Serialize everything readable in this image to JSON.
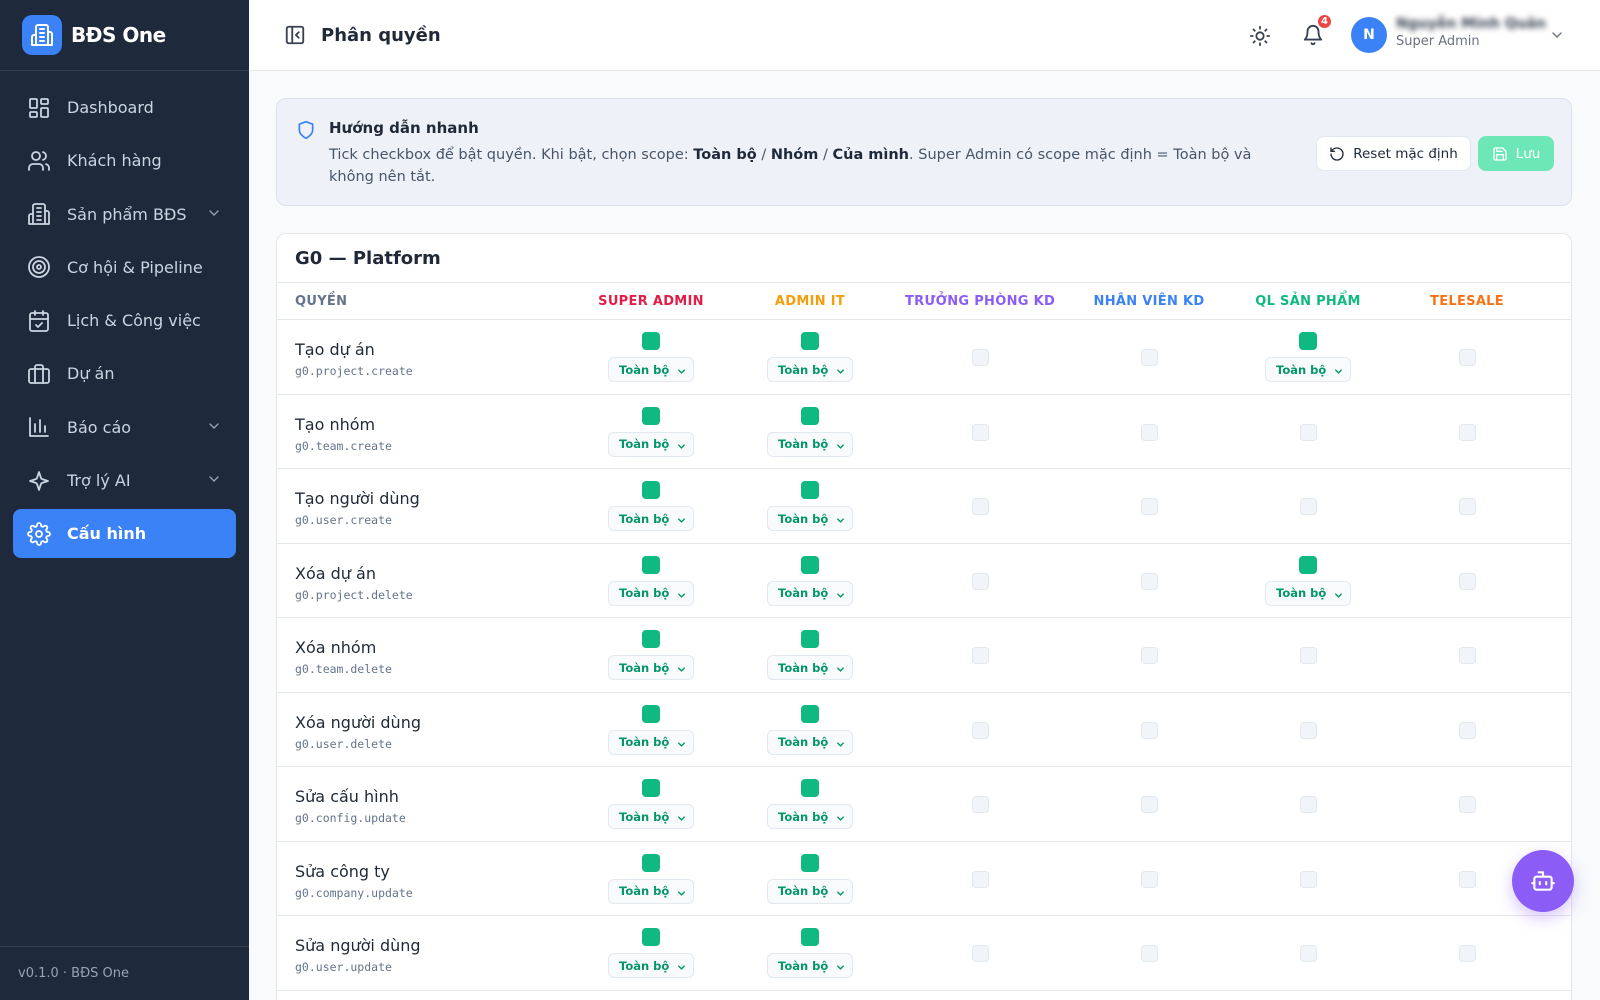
{
  "brand": {
    "name": "BĐS One"
  },
  "sidebar": {
    "items": [
      {
        "label": "Dashboard",
        "icon": "dashboard-icon"
      },
      {
        "label": "Khách hàng",
        "icon": "users-icon"
      },
      {
        "label": "Sản phẩm BĐS",
        "icon": "building-icon",
        "expandable": true
      },
      {
        "label": "Cơ hội & Pipeline",
        "icon": "target-icon"
      },
      {
        "label": "Lịch & Công việc",
        "icon": "calendar-icon"
      },
      {
        "label": "Dự án",
        "icon": "briefcase-icon"
      },
      {
        "label": "Báo cáo",
        "icon": "chart-icon",
        "expandable": true
      },
      {
        "label": "Trợ lý AI",
        "icon": "sparkles-icon",
        "expandable": true
      },
      {
        "label": "Cấu hình",
        "icon": "gear-icon",
        "active": true
      }
    ],
    "footer": "v0.1.0 · BĐS One"
  },
  "header": {
    "title": "Phân quyền",
    "notifications_count": "4",
    "avatar_initial": "N",
    "user_name": "Nguyễn Minh Quân",
    "user_role": "Super Admin"
  },
  "guide": {
    "title": "Hướng dẫn nhanh",
    "text_1": "Tick checkbox để bật quyền. Khi bật, chọn scope: ",
    "scope_all": "Toàn bộ",
    "sep": " / ",
    "scope_group": "Nhóm",
    "scope_own": "Của mình",
    "text_2": ". Super Admin có scope mặc định = Toàn bộ và không nên tắt.",
    "reset_label": "Reset mặc định",
    "save_label": "Lưu"
  },
  "colors": {
    "accent": "#3b82f6",
    "enabled": "#10b981",
    "sidebar_bg": "#1e293b",
    "fab": "#8b5cf6"
  },
  "permissions": {
    "group_title": "G0 — Platform",
    "perm_header": "QUYỀN",
    "roles": [
      {
        "label": "SUPER ADMIN",
        "color": "#e11d48"
      },
      {
        "label": "ADMIN IT",
        "color": "#f59e0b"
      },
      {
        "label": "TRƯỞNG PHÒNG KD",
        "color": "#8b5cf6"
      },
      {
        "label": "NHÂN VIÊN KD",
        "color": "#3b82f6"
      },
      {
        "label": "QL SẢN PHẨM",
        "color": "#10b981"
      },
      {
        "label": "TELESALE",
        "color": "#f97316"
      }
    ],
    "rows": [
      {
        "name": "Tạo dự án",
        "code": "g0.project.create",
        "enabled": [
          true,
          true,
          false,
          false,
          true,
          false
        ],
        "scope": "Toàn bộ"
      },
      {
        "name": "Tạo nhóm",
        "code": "g0.team.create",
        "enabled": [
          true,
          true,
          false,
          false,
          false,
          false
        ],
        "scope": "Toàn bộ"
      },
      {
        "name": "Tạo người dùng",
        "code": "g0.user.create",
        "enabled": [
          true,
          true,
          false,
          false,
          false,
          false
        ],
        "scope": "Toàn bộ"
      },
      {
        "name": "Xóa dự án",
        "code": "g0.project.delete",
        "enabled": [
          true,
          true,
          false,
          false,
          true,
          false
        ],
        "scope": "Toàn bộ"
      },
      {
        "name": "Xóa nhóm",
        "code": "g0.team.delete",
        "enabled": [
          true,
          true,
          false,
          false,
          false,
          false
        ],
        "scope": "Toàn bộ"
      },
      {
        "name": "Xóa người dùng",
        "code": "g0.user.delete",
        "enabled": [
          true,
          true,
          false,
          false,
          false,
          false
        ],
        "scope": "Toàn bộ"
      },
      {
        "name": "Sửa cấu hình",
        "code": "g0.config.update",
        "enabled": [
          true,
          true,
          false,
          false,
          false,
          false
        ],
        "scope": "Toàn bộ"
      },
      {
        "name": "Sửa công ty",
        "code": "g0.company.update",
        "enabled": [
          true,
          true,
          false,
          false,
          false,
          false
        ],
        "scope": "Toàn bộ"
      },
      {
        "name": "Sửa người dùng",
        "code": "g0.user.update",
        "enabled": [
          true,
          true,
          false,
          false,
          false,
          false
        ],
        "scope": "Toàn bộ"
      }
    ]
  }
}
